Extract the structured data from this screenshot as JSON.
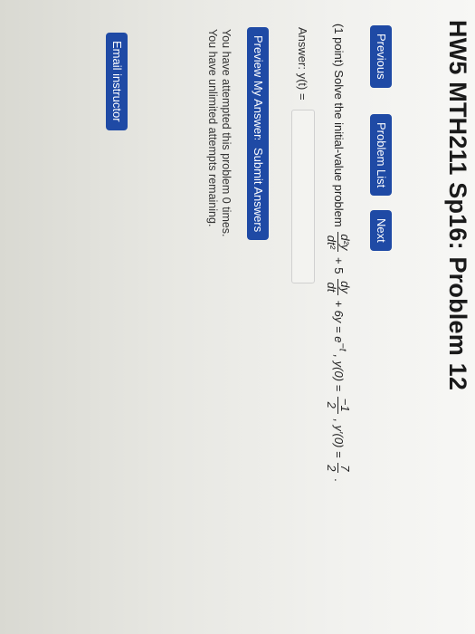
{
  "header": {
    "title": "HW5 MTH211 Sp16: Problem 12"
  },
  "nav": {
    "previous_label": "Previous",
    "problem_list_label": "Problem List",
    "next_label": "Next"
  },
  "problem": {
    "prefix": "(1 point) Solve the initial-value problem",
    "d2y": "d²y",
    "dt2": "dt²",
    "plus5": "+ 5",
    "dy": "dy",
    "dt": "dt",
    "rest": "+ 6y = e",
    "exp": "−t",
    "cond1": ", y(0) =",
    "n1": "−1",
    "d1": "2",
    "cond2": ", y′(0) =",
    "n2": "7",
    "d2": "2",
    "end": "."
  },
  "answer": {
    "label": "Answer: y(t) =",
    "value": ""
  },
  "actions": {
    "preview_label": "Preview My Answers",
    "submit_label": "Submit Answers"
  },
  "attempts": {
    "line1": "You have attempted this problem 0 times.",
    "line2": "You have unlimited attempts remaining."
  },
  "footer": {
    "email_label": "Email instructor"
  }
}
